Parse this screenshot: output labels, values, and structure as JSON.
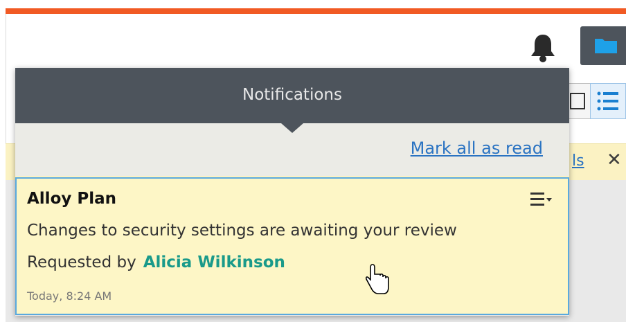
{
  "notifications": {
    "title": "Notifications",
    "mark_all_label": "Mark all as read",
    "items": [
      {
        "title": "Alloy Plan",
        "message": "Changes to security settings are awaiting your review",
        "requested_by_label": "Requested by",
        "requested_by_user": "Alicia Wilkinson",
        "time": "Today, 8:24 AM"
      }
    ]
  },
  "banner": {
    "link_partial": "ls",
    "close_symbol": "✕"
  },
  "icons": {
    "bell": "bell-icon",
    "folder": "folder-icon",
    "grid_view": "grid-view-icon",
    "list_view": "list-view-icon",
    "item_menu": "menu-dropdown-icon",
    "cursor": "hand-pointer-icon"
  },
  "colors": {
    "accent_bar": "#f15a24",
    "header_bg": "#4d545c",
    "card_bg": "#fdf6c6",
    "card_border": "#5aa9de",
    "link": "#2a73c2",
    "user_link": "#1a9a8a"
  }
}
